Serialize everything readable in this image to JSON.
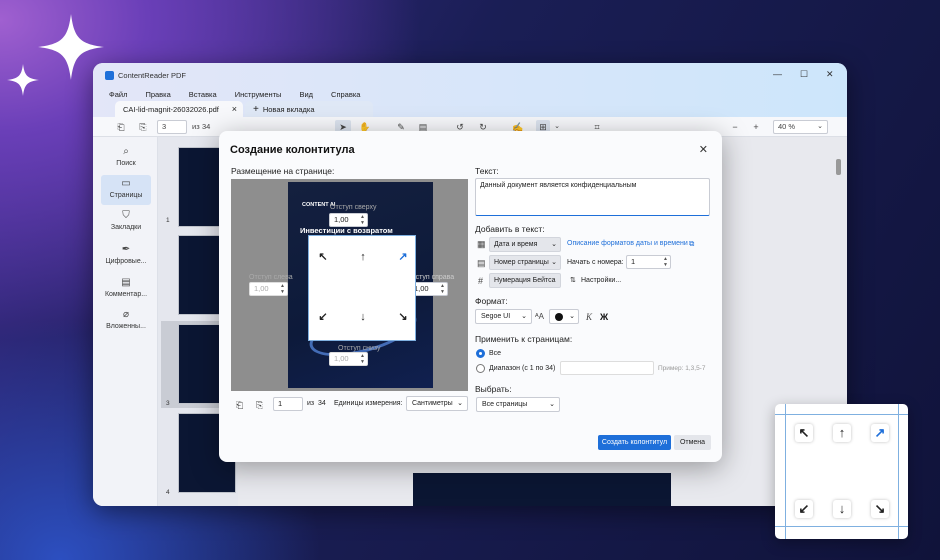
{
  "app": {
    "title": "ContentReader PDF",
    "minimize": "—",
    "maximize": "☐",
    "close": "✕"
  },
  "menu": [
    "Файл",
    "Правка",
    "Вставка",
    "Инструменты",
    "Вид",
    "Справка"
  ],
  "tabs": {
    "active": "CAI-lid-magnit-26032026.pdf",
    "close": "×",
    "new_tab": "Новая вкладка"
  },
  "toolbar": {
    "page_value": "3",
    "page_of": "из",
    "page_total": "34",
    "zoom_value": "40 %"
  },
  "sidebar": [
    {
      "label": "Поиск",
      "icon": "search-icon"
    },
    {
      "label": "Страницы",
      "icon": "pages-icon"
    },
    {
      "label": "Закладки",
      "icon": "bookmark-icon"
    },
    {
      "label": "Цифровые...",
      "icon": "signature-icon"
    },
    {
      "label": "Комментар...",
      "icon": "comment-icon"
    },
    {
      "label": "Вложенны...",
      "icon": "attachment-icon"
    }
  ],
  "thumbnails": [
    "1",
    "2",
    "3",
    "4"
  ],
  "dialog": {
    "title": "Создание колонтитула",
    "placement_label": "Размещение на странице:",
    "preview_logo": "CONTENT AI",
    "preview_headline": "Инвестиции с возвратом",
    "margin_top_label": "Отступ сверху",
    "margin_left_label": "Отступ слева",
    "margin_right_label": "Отступ справа",
    "margin_bottom_label": "Отступ снизу",
    "margin_top": "1,00",
    "margin_left": "1,00",
    "margin_right": "1,00",
    "margin_bottom": "1,00",
    "preview_page": "1",
    "preview_of": "из",
    "preview_total": "34",
    "units_label": "Единицы измерения:",
    "units_value": "Сантиметры",
    "text_label": "Текст:",
    "text_value": "Данный документ является конфиденциальным",
    "add_label": "Добавить в текст:",
    "date_btn": "Дата и время",
    "date_formats_link": "Описание форматов даты и времени",
    "page_num_btn": "Номер страницы",
    "start_from_label": "Начать с номера:",
    "start_from_value": "1",
    "bates_btn": "Нумерация Бейтса",
    "settings_label": "Настройки...",
    "format_label": "Формат:",
    "font_value": "Segoe UI",
    "italic": "К",
    "bold": "Ж",
    "apply_label": "Применить к страницам:",
    "radio_all": "Все",
    "radio_range": "Диапазон (с 1 по 34)",
    "range_example": "Пример: 1,3,5-7",
    "select_label": "Выбрать:",
    "select_value": "Все страницы",
    "create_btn": "Создать колонтитул",
    "cancel_btn": "Отмена"
  }
}
